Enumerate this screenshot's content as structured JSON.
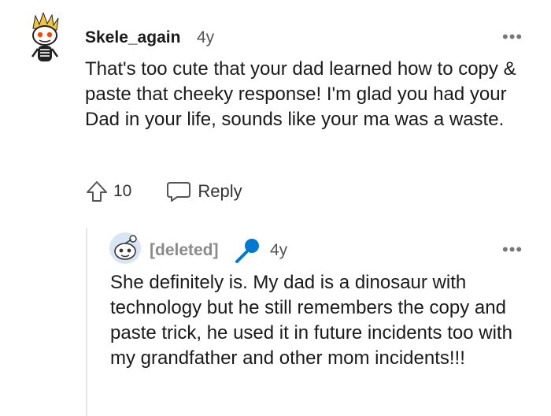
{
  "comments": [
    {
      "username": "Skele_again",
      "age": "4y",
      "more": "•••",
      "body": "That's too cute that your dad learned how to copy & paste that cheeky response! I'm glad you had your Dad in your life, sounds like your ma was a waste.",
      "vote_count": "10",
      "reply_label": "Reply",
      "icons": [
        "skeleton-avatar-icon",
        "upvote-arrow-icon",
        "reply-bubble-icon",
        "more-options-icon"
      ]
    },
    {
      "username": "[deleted]",
      "age": "4y",
      "more": "•••",
      "body": "She definitely is. My dad is a dinosaur with technology but he still remembers the copy and paste trick, he used it in future incidents too with my grandfather and other mom incidents!!!",
      "icons": [
        "default-snoo-avatar-icon",
        "microphone-icon",
        "more-options-icon"
      ]
    }
  ],
  "colors": {
    "accent": "#0079d3",
    "muted": "#8a8a8a",
    "thread_line": "#e5e5e5"
  }
}
